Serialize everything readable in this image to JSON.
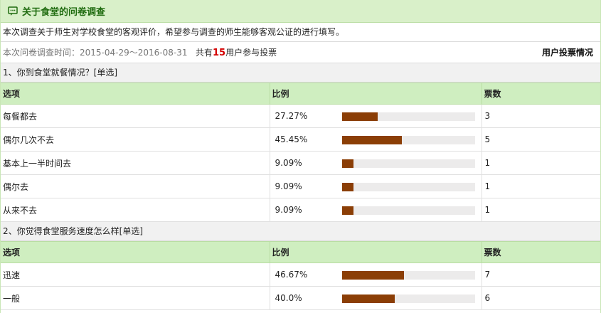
{
  "survey": {
    "title": "关于食堂的问卷调查",
    "intro": "本次调查关于师生对学校食堂的客观评价，希望参与调查的师生能够客观公证的进行填写。",
    "time_label": "本次问卷调查时间：2015-04-29～2016-08-31",
    "participants_prefix": "共有",
    "participants_count": "15",
    "participants_suffix": "用户参与投票",
    "vote_status_link": "用户投票情况"
  },
  "columns": {
    "option": "选项",
    "ratio": "比例",
    "votes": "票数"
  },
  "questions": [
    {
      "title": "1、你到食堂就餐情况？[单选]",
      "options": [
        {
          "label": "每餐都去",
          "percent": "27.27%",
          "fraction": 0.2727,
          "votes": "3"
        },
        {
          "label": "偶尔几次不去",
          "percent": "45.45%",
          "fraction": 0.4545,
          "votes": "5"
        },
        {
          "label": "基本上一半时间去",
          "percent": "9.09%",
          "fraction": 0.0909,
          "votes": "1"
        },
        {
          "label": "偶尔去",
          "percent": "9.09%",
          "fraction": 0.0909,
          "votes": "1"
        },
        {
          "label": "从来不去",
          "percent": "9.09%",
          "fraction": 0.0909,
          "votes": "1"
        }
      ]
    },
    {
      "title": "2、你觉得食堂服务速度怎么样[单选]",
      "options": [
        {
          "label": "迅速",
          "percent": "46.67%",
          "fraction": 0.4667,
          "votes": "7"
        },
        {
          "label": "一般",
          "percent": "40.0%",
          "fraction": 0.4,
          "votes": "6"
        }
      ]
    }
  ],
  "colors": {
    "header_bg": "#d9f0c9",
    "bar_fill": "#8b3e06",
    "bar_track": "#ecebeb",
    "count_red": "#d40000"
  }
}
